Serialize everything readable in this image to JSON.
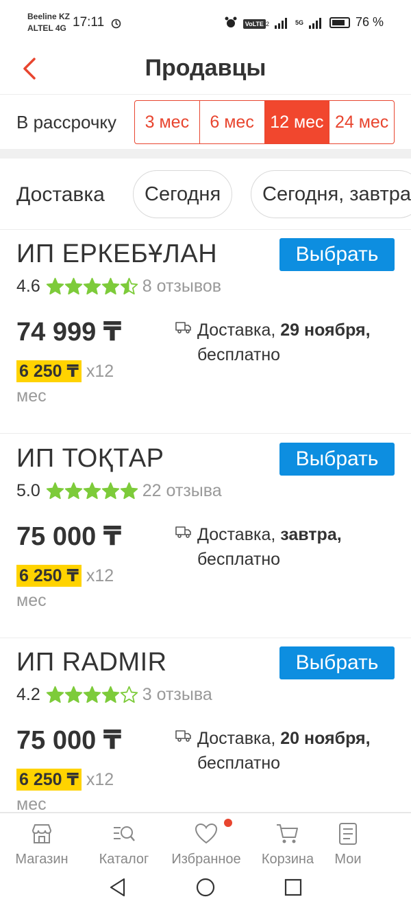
{
  "status_bar": {
    "carrier1": "Beeline KZ",
    "carrier2": "ALTEL 4G",
    "time": "17:11",
    "volte": "VoLTE",
    "volte_sub": "2",
    "network": "5G",
    "battery": "76 %"
  },
  "header": {
    "title": "Продавцы"
  },
  "installment": {
    "label": "В рассрочку",
    "options": [
      "3 мес",
      "6 мес",
      "12 мес",
      "24 мес"
    ],
    "selected": "12 мес"
  },
  "delivery_filter": {
    "label": "Доставка",
    "chips": [
      "Сегодня",
      "Сегодня, завтра"
    ]
  },
  "sellers": [
    {
      "name": "ИП ЕРКЕБҰЛАН",
      "button": "Выбрать",
      "rating": "4.6",
      "stars": 4.5,
      "reviews": "8 отзывов",
      "price": "74 999 ₸",
      "monthly": "6 250 ₸",
      "multiplier": "x12",
      "unit": "мес",
      "delivery_label": "Доставка,",
      "delivery_date": "29 ноября,",
      "delivery_cost": "бесплатно"
    },
    {
      "name": "ИП ТОҚТАР",
      "button": "Выбрать",
      "rating": "5.0",
      "stars": 5,
      "reviews": "22 отзыва",
      "price": "75 000 ₸",
      "monthly": "6 250 ₸",
      "multiplier": "x12",
      "unit": "мес",
      "delivery_label": "Доставка,",
      "delivery_date": "завтра,",
      "delivery_cost": "бесплатно"
    },
    {
      "name": "ИП RADMIR",
      "button": "Выбрать",
      "rating": "4.2",
      "stars": 4,
      "reviews": "3 отзыва",
      "price": "75 000 ₸",
      "monthly": "6 250 ₸",
      "multiplier": "x12",
      "unit": "мес",
      "delivery_label": "Доставка,",
      "delivery_date": "20 ноября,",
      "delivery_cost": "бесплатно"
    }
  ],
  "bottom_nav": [
    {
      "label": "Магазин",
      "icon": "shop-icon"
    },
    {
      "label": "Каталог",
      "icon": "catalog-icon"
    },
    {
      "label": "Избранное",
      "icon": "heart-icon",
      "badge": true
    },
    {
      "label": "Корзина",
      "icon": "cart-icon"
    },
    {
      "label": "Мои",
      "icon": "orders-icon"
    }
  ],
  "colors": {
    "accent": "#f1472e",
    "button": "#0d8ee0",
    "star": "#7dcb3a",
    "highlight": "#ffd300"
  }
}
